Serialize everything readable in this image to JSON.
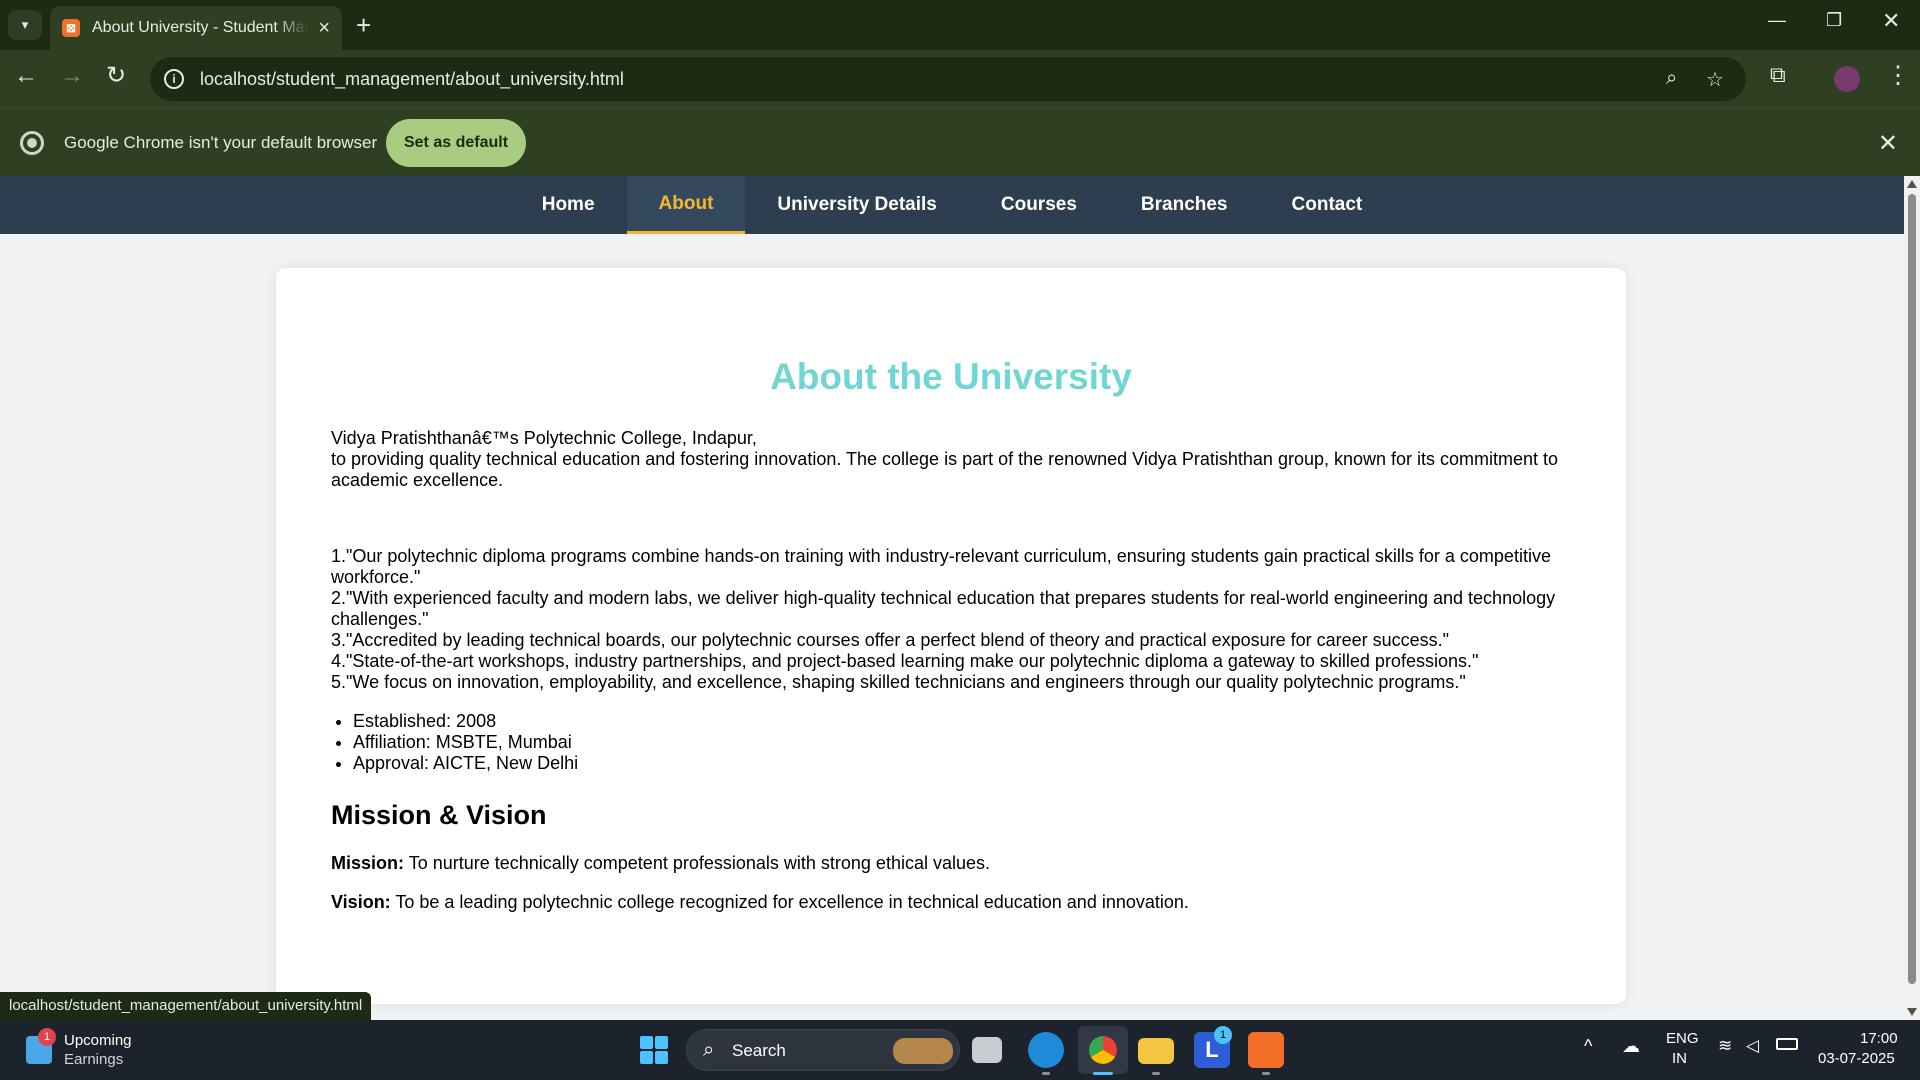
{
  "browser": {
    "tab_title": "About University - Student Management",
    "url": "localhost/student_management/about_university.html",
    "infobar_text": "Google Chrome isn't your default browser",
    "set_default_label": "Set as default",
    "status_url": "localhost/student_management/about_university.html"
  },
  "nav": {
    "items": [
      {
        "label": "Home"
      },
      {
        "label": "About"
      },
      {
        "label": "University Details"
      },
      {
        "label": "Courses"
      },
      {
        "label": "Branches"
      },
      {
        "label": "Contact"
      }
    ],
    "active_index": 1
  },
  "content": {
    "title": "About the University",
    "intro_line1": "Vidya Pratishthanâ€™s Polytechnic College, Indapur,",
    "intro_line2": "to providing quality technical education and fostering innovation. The college is part of the renowned Vidya Pratishthan group, known for its commitment to academic excellence.",
    "points": [
      "1.\"Our polytechnic diploma programs combine hands-on training with industry-relevant curriculum, ensuring students gain practical skills for a competitive workforce.\"",
      "2.\"With experienced faculty and modern labs, we deliver high-quality technical education that prepares students for real-world engineering and technology challenges.\"",
      "3.\"Accredited by leading technical boards, our polytechnic courses offer a perfect blend of theory and practical exposure for career success.\"",
      "4.\"State-of-the-art workshops, industry partnerships, and project-based learning make our polytechnic diploma a gateway to skilled professions.\"",
      "5.\"We focus on innovation, employability, and excellence, shaping skilled technicians and engineers through our quality polytechnic programs.\""
    ],
    "facts": [
      "Established: 2008",
      "Affiliation: MSBTE, Mumbai",
      "Approval: AICTE, New Delhi"
    ],
    "mission_heading": "Mission & Vision",
    "mission_label": "Mission:",
    "mission_text": " To nurture technically competent professionals with strong ethical values.",
    "vision_label": "Vision:",
    "vision_text": " To be a leading polytechnic college recognized for excellence in technical education and innovation."
  },
  "taskbar": {
    "weather_title": "Upcoming",
    "weather_sub": "Earnings",
    "weather_badge": "1",
    "search_label": "Search",
    "lang_top": "ENG",
    "lang_bottom": "IN",
    "time": "17:00",
    "date": "03-07-2025",
    "l_badge": "1"
  },
  "colors": {
    "nav_bg": "#2c3e50",
    "nav_active": "#f5b82e",
    "title": "#6fd6d3",
    "chrome_frame": "#2f3f22",
    "set_default_bg": "#a9cd80"
  },
  "icons": [
    "tab-search-icon",
    "xampp-favicon-icon",
    "close-icon",
    "new-tab-icon",
    "minimize-icon",
    "maximize-icon",
    "back-icon",
    "forward-icon",
    "reload-icon",
    "site-info-icon",
    "zoom-icon",
    "bookmark-star-icon",
    "extensions-icon",
    "profile-avatar",
    "menu-kebab-icon",
    "chrome-logo-icon",
    "windows-start-icon",
    "search-icon",
    "wifi-icon",
    "volume-icon",
    "battery-icon"
  ]
}
